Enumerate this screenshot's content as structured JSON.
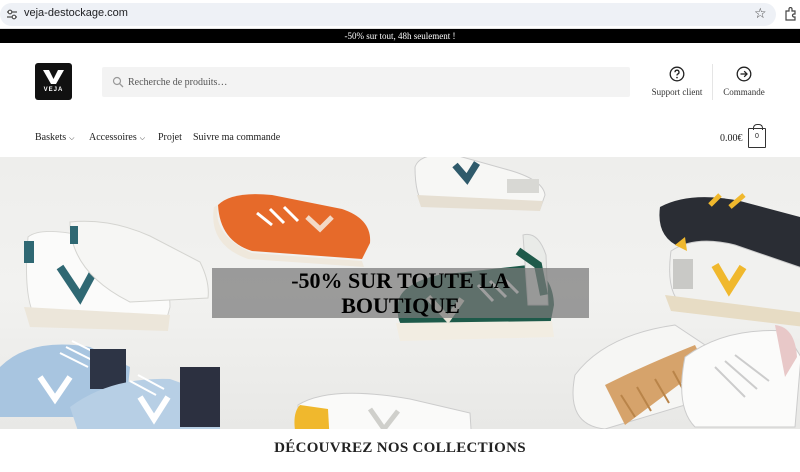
{
  "browser": {
    "url": "veja-destockage.com",
    "icons": [
      "tune-icon",
      "star-icon",
      "extensions-icon"
    ]
  },
  "promo": {
    "text": "-50% sur tout, 48h seulement !"
  },
  "header": {
    "logo_text": "VEJA",
    "search_placeholder": "Recherche de produits…",
    "support_label": "Support client",
    "commande_label": "Commande"
  },
  "nav": {
    "items": [
      {
        "label": "Baskets",
        "dropdown": true
      },
      {
        "label": "Accessoires",
        "dropdown": true
      },
      {
        "label": "Projet",
        "dropdown": false
      },
      {
        "label": "Suivre ma commande",
        "dropdown": false
      }
    ],
    "cart_total": "0.00€",
    "cart_count": "0"
  },
  "hero": {
    "title_line1": "-50% SUR TOUTE LA",
    "title_line2": "BOUTIQUE"
  },
  "section": {
    "collections_title": "DÉCOUVREZ NOS COLLECTIONS"
  },
  "colors": {
    "brand": "#111111",
    "promo_bg": "#000000",
    "search_bg": "#f3f3f3"
  }
}
